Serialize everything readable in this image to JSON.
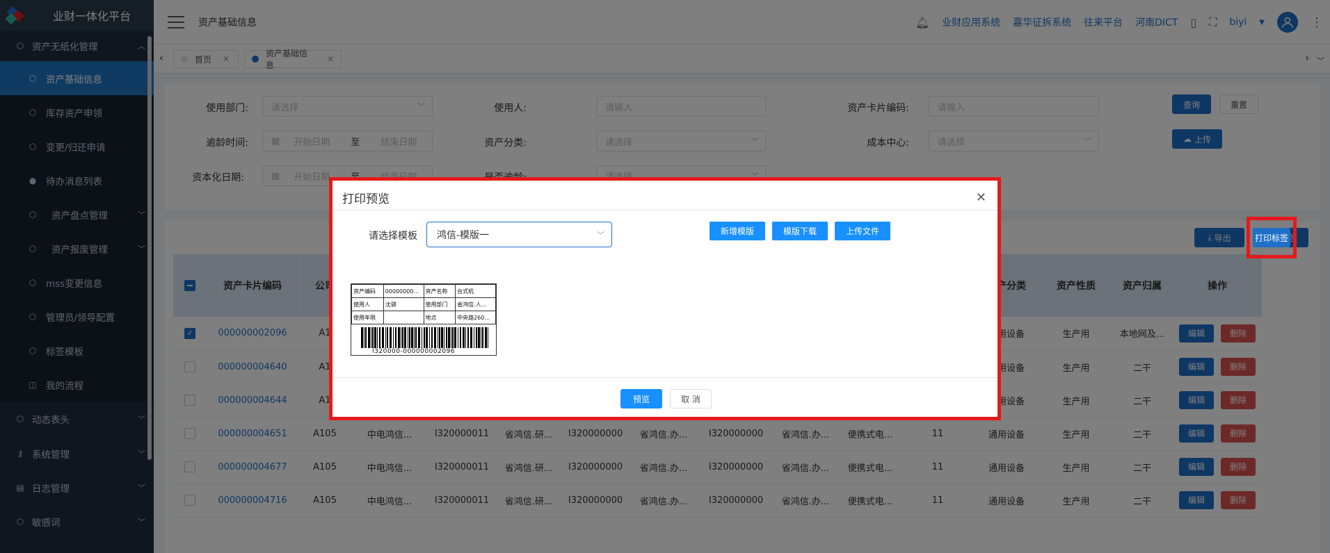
{
  "app": {
    "title": "业财一体化平台"
  },
  "sidebar": {
    "groups": [
      {
        "label": "资产无纸化管理",
        "icon": "cube-icon",
        "expanded": true
      },
      {
        "label": "动态表头",
        "icon": "cube-icon"
      },
      {
        "label": "系统管理",
        "icon": "key-icon"
      },
      {
        "label": "日志管理",
        "icon": "list-icon"
      },
      {
        "label": "敏感词",
        "icon": "cube-icon"
      }
    ],
    "items": [
      {
        "label": "资产基础信息",
        "active": true
      },
      {
        "label": "库存资产申领"
      },
      {
        "label": "变更/归还申请"
      },
      {
        "label": "待办消息列表"
      },
      {
        "label": "资产盘点管理"
      },
      {
        "label": "资产报废管理"
      },
      {
        "label": "mss变更信息"
      },
      {
        "label": "管理员/领导配置"
      },
      {
        "label": "标签模板"
      },
      {
        "label": "我的流程"
      }
    ]
  },
  "header": {
    "page_title": "资产基础信息",
    "links": [
      "业财应用系统",
      "嘉华征拆系统",
      "往来平台",
      "河南DICT"
    ],
    "user": "biyi"
  },
  "tabs": [
    {
      "label": "首页"
    },
    {
      "label": "资产基础信息"
    }
  ],
  "filter": {
    "dept_label": "使用部门:",
    "dept_placeholder": "请选择",
    "user_label": "使用人:",
    "user_placeholder": "请输入",
    "card_label": "资产卡片编码:",
    "card_placeholder": "请输入",
    "age_label": "逾龄时间:",
    "start_placeholder": "开始日期",
    "to": "至",
    "end_placeholder": "结束日期",
    "cat_label": "资产分类:",
    "cat_placeholder": "请选择",
    "cost_label": "成本中心:",
    "cost_placeholder": "请选择",
    "cap_label": "资本化日期:",
    "overdue_label": "是否逾龄:",
    "query": "查询",
    "reset": "重置",
    "upload": "上传"
  },
  "toolbar": {
    "export": "导出",
    "print": "打印标签"
  },
  "table": {
    "headers": [
      "资产卡片编码",
      "公司",
      "",
      "",
      "",
      "",
      "",
      "",
      "",
      "",
      "",
      "资产分类",
      "资产性质",
      "资产归属",
      "操作"
    ],
    "rows": [
      [
        "000000002096",
        "A1",
        "",
        "",
        "",
        "",
        "",
        "",
        "",
        "",
        "",
        "通用设备",
        "生产用",
        "本地网及..."
      ],
      [
        "000000004640",
        "A1",
        "",
        "",
        "",
        "",
        "",
        "",
        "",
        "",
        "",
        "通用设备",
        "生产用",
        "二干"
      ],
      [
        "000000004644",
        "A1",
        "",
        "",
        "",
        "",
        "",
        "",
        "",
        "",
        "",
        "通用设备",
        "生产用",
        "二干"
      ],
      [
        "000000004651",
        "A105",
        "中电鸿信...",
        "I320000011",
        "省鸿信.研...",
        "I320000000",
        "省鸿信.办...",
        "I320000000",
        "省鸿信.办...",
        "便携式电...",
        "11",
        "通用设备",
        "生产用",
        "二干"
      ],
      [
        "000000004677",
        "A105",
        "中电鸿信...",
        "I320000011",
        "省鸿信.研...",
        "I320000000",
        "省鸿信.办...",
        "I320000000",
        "省鸿信.办...",
        "便携式电...",
        "11",
        "通用设备",
        "生产用",
        "二干"
      ],
      [
        "000000004716",
        "A105",
        "中电鸿信...",
        "I320000011",
        "省鸿信.研...",
        "I320000000",
        "省鸿信.办...",
        "I320000000",
        "省鸿信.办...",
        "便携式电...",
        "11",
        "通用设备",
        "生产用",
        "二干"
      ]
    ],
    "edit": "编辑",
    "delete": "删除"
  },
  "modal": {
    "title": "打印预览",
    "template_label": "请选择模板",
    "template_value": "鸿信-模版一",
    "add_template": "新增模版",
    "download_template": "模版下载",
    "upload_file": "上传文件",
    "preview": "预览",
    "cancel": "取 消",
    "label": {
      "rows": [
        [
          "资产编码",
          "00000000...",
          "资产名称",
          "台式机"
        ],
        [
          "使用人",
          "沈骐",
          "使用部门",
          "省鸿信.人..."
        ],
        [
          "使用年限",
          "",
          "地点",
          "中央路260..."
        ]
      ],
      "barcode_text": "I320000-000000002096"
    }
  },
  "colors": {
    "primary": "#1f6fc7",
    "danger": "#d9534f",
    "highlight": "#e5191b",
    "sidebar": "#1f2d3d"
  }
}
